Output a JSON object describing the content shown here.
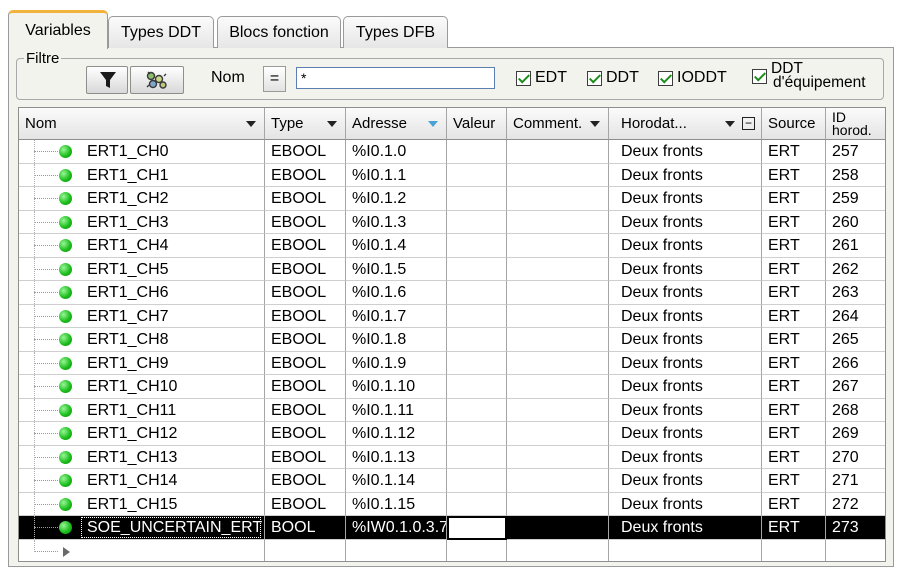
{
  "tabs": [
    {
      "label": "Variables",
      "active": true
    },
    {
      "label": "Types DDT",
      "active": false
    },
    {
      "label": "Blocs fonction",
      "active": false
    },
    {
      "label": "Types DFB",
      "active": false
    }
  ],
  "filter": {
    "legend": "Filtre",
    "name_label": "Nom",
    "operator": "=",
    "name_value": "*",
    "checkboxes": [
      {
        "label": "EDT",
        "checked": true
      },
      {
        "label": "DDT",
        "checked": true
      },
      {
        "label": "IODDT",
        "checked": true
      },
      {
        "label_line1": "DDT",
        "label_line2": "d'équipement",
        "checked": true
      }
    ],
    "icons": [
      "funnel-icon",
      "variable-filter-icon"
    ]
  },
  "columns": {
    "name": "Nom",
    "type": "Type",
    "address": "Adresse",
    "value": "Valeur",
    "comment": "Comment.",
    "timestamp": "Horodat...",
    "source": "Source",
    "id_line1": "ID",
    "id_line2": "horod."
  },
  "rows": [
    {
      "name": "ERT1_CH0",
      "type": "EBOOL",
      "address": "%I0.1.0",
      "value": "",
      "comment": "",
      "timestamp": "Deux fronts",
      "source": "ERT",
      "id": "257"
    },
    {
      "name": "ERT1_CH1",
      "type": "EBOOL",
      "address": "%I0.1.1",
      "value": "",
      "comment": "",
      "timestamp": "Deux fronts",
      "source": "ERT",
      "id": "258"
    },
    {
      "name": "ERT1_CH2",
      "type": "EBOOL",
      "address": "%I0.1.2",
      "value": "",
      "comment": "",
      "timestamp": "Deux fronts",
      "source": "ERT",
      "id": "259"
    },
    {
      "name": "ERT1_CH3",
      "type": "EBOOL",
      "address": "%I0.1.3",
      "value": "",
      "comment": "",
      "timestamp": "Deux fronts",
      "source": "ERT",
      "id": "260"
    },
    {
      "name": "ERT1_CH4",
      "type": "EBOOL",
      "address": "%I0.1.4",
      "value": "",
      "comment": "",
      "timestamp": "Deux fronts",
      "source": "ERT",
      "id": "261"
    },
    {
      "name": "ERT1_CH5",
      "type": "EBOOL",
      "address": "%I0.1.5",
      "value": "",
      "comment": "",
      "timestamp": "Deux fronts",
      "source": "ERT",
      "id": "262"
    },
    {
      "name": "ERT1_CH6",
      "type": "EBOOL",
      "address": "%I0.1.6",
      "value": "",
      "comment": "",
      "timestamp": "Deux fronts",
      "source": "ERT",
      "id": "263"
    },
    {
      "name": "ERT1_CH7",
      "type": "EBOOL",
      "address": "%I0.1.7",
      "value": "",
      "comment": "",
      "timestamp": "Deux fronts",
      "source": "ERT",
      "id": "264"
    },
    {
      "name": "ERT1_CH8",
      "type": "EBOOL",
      "address": "%I0.1.8",
      "value": "",
      "comment": "",
      "timestamp": "Deux fronts",
      "source": "ERT",
      "id": "265"
    },
    {
      "name": "ERT1_CH9",
      "type": "EBOOL",
      "address": "%I0.1.9",
      "value": "",
      "comment": "",
      "timestamp": "Deux fronts",
      "source": "ERT",
      "id": "266"
    },
    {
      "name": "ERT1_CH10",
      "type": "EBOOL",
      "address": "%I0.1.10",
      "value": "",
      "comment": "",
      "timestamp": "Deux fronts",
      "source": "ERT",
      "id": "267"
    },
    {
      "name": "ERT1_CH11",
      "type": "EBOOL",
      "address": "%I0.1.11",
      "value": "",
      "comment": "",
      "timestamp": "Deux fronts",
      "source": "ERT",
      "id": "268"
    },
    {
      "name": "ERT1_CH12",
      "type": "EBOOL",
      "address": "%I0.1.12",
      "value": "",
      "comment": "",
      "timestamp": "Deux fronts",
      "source": "ERT",
      "id": "269"
    },
    {
      "name": "ERT1_CH13",
      "type": "EBOOL",
      "address": "%I0.1.13",
      "value": "",
      "comment": "",
      "timestamp": "Deux fronts",
      "source": "ERT",
      "id": "270"
    },
    {
      "name": "ERT1_CH14",
      "type": "EBOOL",
      "address": "%I0.1.14",
      "value": "",
      "comment": "",
      "timestamp": "Deux fronts",
      "source": "ERT",
      "id": "271"
    },
    {
      "name": "ERT1_CH15",
      "type": "EBOOL",
      "address": "%I0.1.15",
      "value": "",
      "comment": "",
      "timestamp": "Deux fronts",
      "source": "ERT",
      "id": "272"
    },
    {
      "name": "SOE_UNCERTAIN_ERT",
      "type": "BOOL",
      "address": "%IW0.1.0.3.7",
      "value": "",
      "comment": "",
      "timestamp": "Deux fronts",
      "source": "ERT",
      "id": "273",
      "selected": true
    }
  ],
  "colors": {
    "tab_accent": "#f2b33d",
    "led_green": "#1cbf1c",
    "selection": "#000000",
    "checkmark": "#1b8e1b"
  }
}
